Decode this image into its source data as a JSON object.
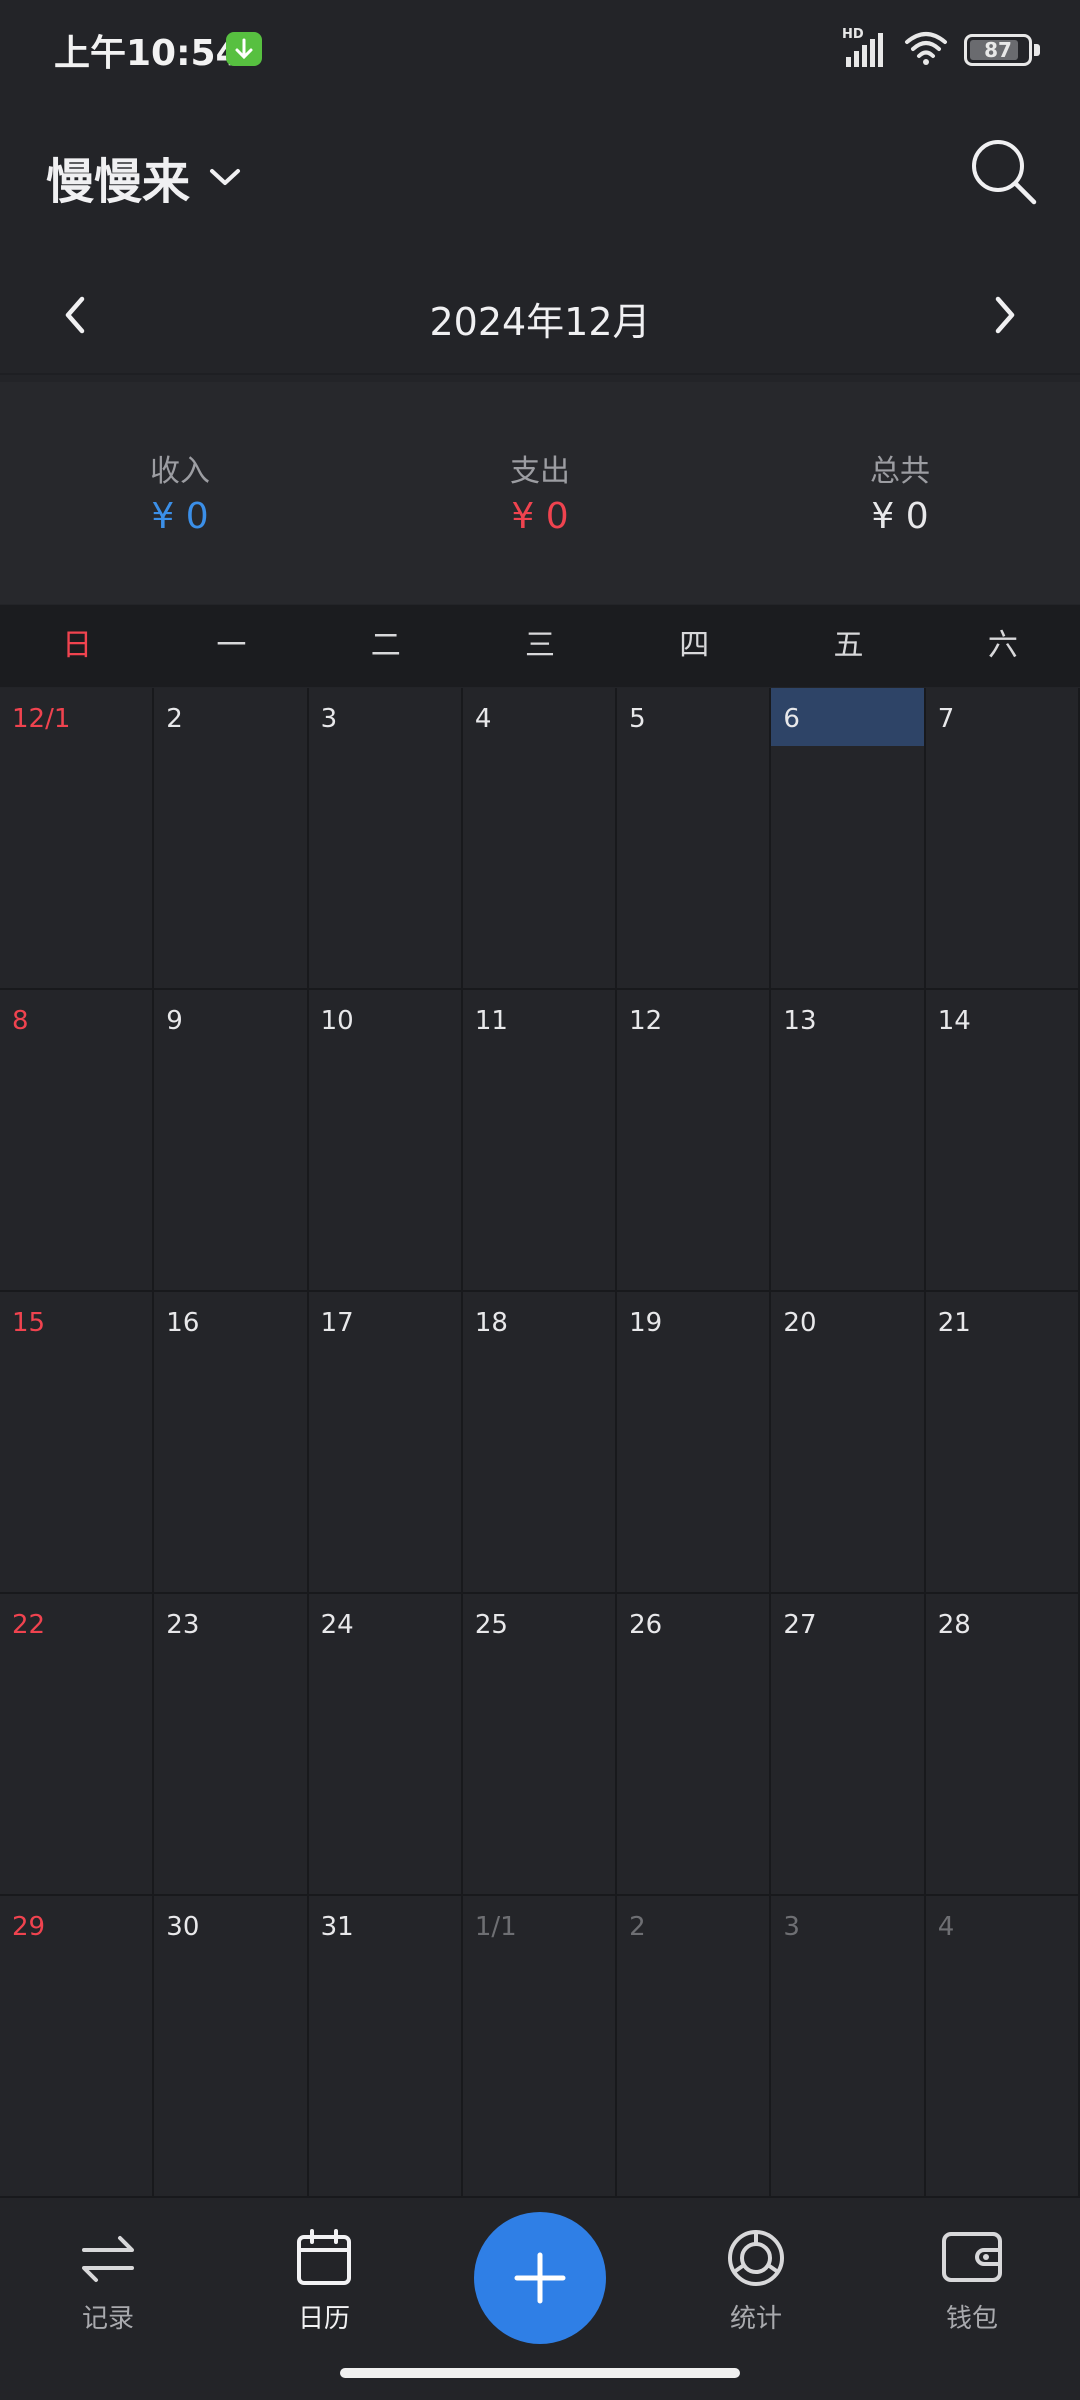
{
  "status": {
    "time": "上午10:54",
    "network": "HD",
    "battery": "87"
  },
  "header": {
    "book_name": "慢慢来"
  },
  "month_nav": {
    "title": "2024年12月"
  },
  "summary": {
    "income_label": "收入",
    "income_value": "¥ 0",
    "expense_label": "支出",
    "expense_value": "¥ 0",
    "total_label": "总共",
    "total_value": "¥ 0"
  },
  "weekdays": [
    "日",
    "一",
    "二",
    "三",
    "四",
    "五",
    "六"
  ],
  "calendar": {
    "cells": [
      {
        "label": "12/1",
        "kind": "sunday"
      },
      {
        "label": "2",
        "kind": "normal"
      },
      {
        "label": "3",
        "kind": "normal"
      },
      {
        "label": "4",
        "kind": "normal"
      },
      {
        "label": "5",
        "kind": "normal"
      },
      {
        "label": "6",
        "kind": "today"
      },
      {
        "label": "7",
        "kind": "normal"
      },
      {
        "label": "8",
        "kind": "sunday"
      },
      {
        "label": "9",
        "kind": "normal"
      },
      {
        "label": "10",
        "kind": "normal"
      },
      {
        "label": "11",
        "kind": "normal"
      },
      {
        "label": "12",
        "kind": "normal"
      },
      {
        "label": "13",
        "kind": "normal"
      },
      {
        "label": "14",
        "kind": "normal"
      },
      {
        "label": "15",
        "kind": "sunday"
      },
      {
        "label": "16",
        "kind": "normal"
      },
      {
        "label": "17",
        "kind": "normal"
      },
      {
        "label": "18",
        "kind": "normal"
      },
      {
        "label": "19",
        "kind": "normal"
      },
      {
        "label": "20",
        "kind": "normal"
      },
      {
        "label": "21",
        "kind": "normal"
      },
      {
        "label": "22",
        "kind": "sunday"
      },
      {
        "label": "23",
        "kind": "normal"
      },
      {
        "label": "24",
        "kind": "normal"
      },
      {
        "label": "25",
        "kind": "normal"
      },
      {
        "label": "26",
        "kind": "normal"
      },
      {
        "label": "27",
        "kind": "normal"
      },
      {
        "label": "28",
        "kind": "normal"
      },
      {
        "label": "29",
        "kind": "sunday"
      },
      {
        "label": "30",
        "kind": "normal"
      },
      {
        "label": "31",
        "kind": "normal"
      },
      {
        "label": "1/1",
        "kind": "other"
      },
      {
        "label": "2",
        "kind": "other"
      },
      {
        "label": "3",
        "kind": "other"
      },
      {
        "label": "4",
        "kind": "other"
      }
    ]
  },
  "bottom_nav": {
    "records": "记录",
    "calendar": "日历",
    "stats": "统计",
    "wallet": "钱包"
  },
  "colors": {
    "income": "#3b8fe8",
    "expense": "#f0434f",
    "sunday": "#f0434f",
    "other_month": "#6e6f73",
    "accent": "#2f7fe6",
    "today_bg": "#2e4467"
  }
}
